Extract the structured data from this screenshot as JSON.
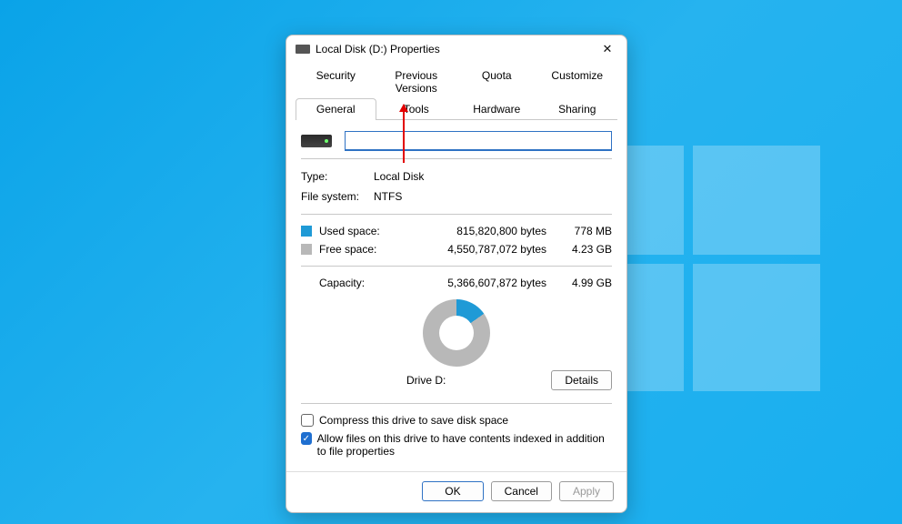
{
  "window": {
    "title": "Local Disk (D:) Properties"
  },
  "tabs": {
    "row1": [
      "Security",
      "Previous Versions",
      "Quota",
      "Customize"
    ],
    "row2": [
      "General",
      "Tools",
      "Hardware",
      "Sharing"
    ],
    "active": "General"
  },
  "general": {
    "name_value": "",
    "type_label": "Type:",
    "type_value": "Local Disk",
    "fs_label": "File system:",
    "fs_value": "NTFS",
    "used": {
      "label": "Used space:",
      "bytes": "815,820,800 bytes",
      "human": "778 MB"
    },
    "free": {
      "label": "Free space:",
      "bytes": "4,550,787,072 bytes",
      "human": "4.23 GB"
    },
    "capacity": {
      "label": "Capacity:",
      "bytes": "5,366,607,872 bytes",
      "human": "4.99 GB"
    },
    "drive_label": "Drive D:",
    "details_btn": "Details",
    "compress_label": "Compress this drive to save disk space",
    "index_label": "Allow files on this drive to have contents indexed in addition to file properties",
    "compress_checked": false,
    "index_checked": true
  },
  "buttons": {
    "ok": "OK",
    "cancel": "Cancel",
    "apply": "Apply"
  }
}
